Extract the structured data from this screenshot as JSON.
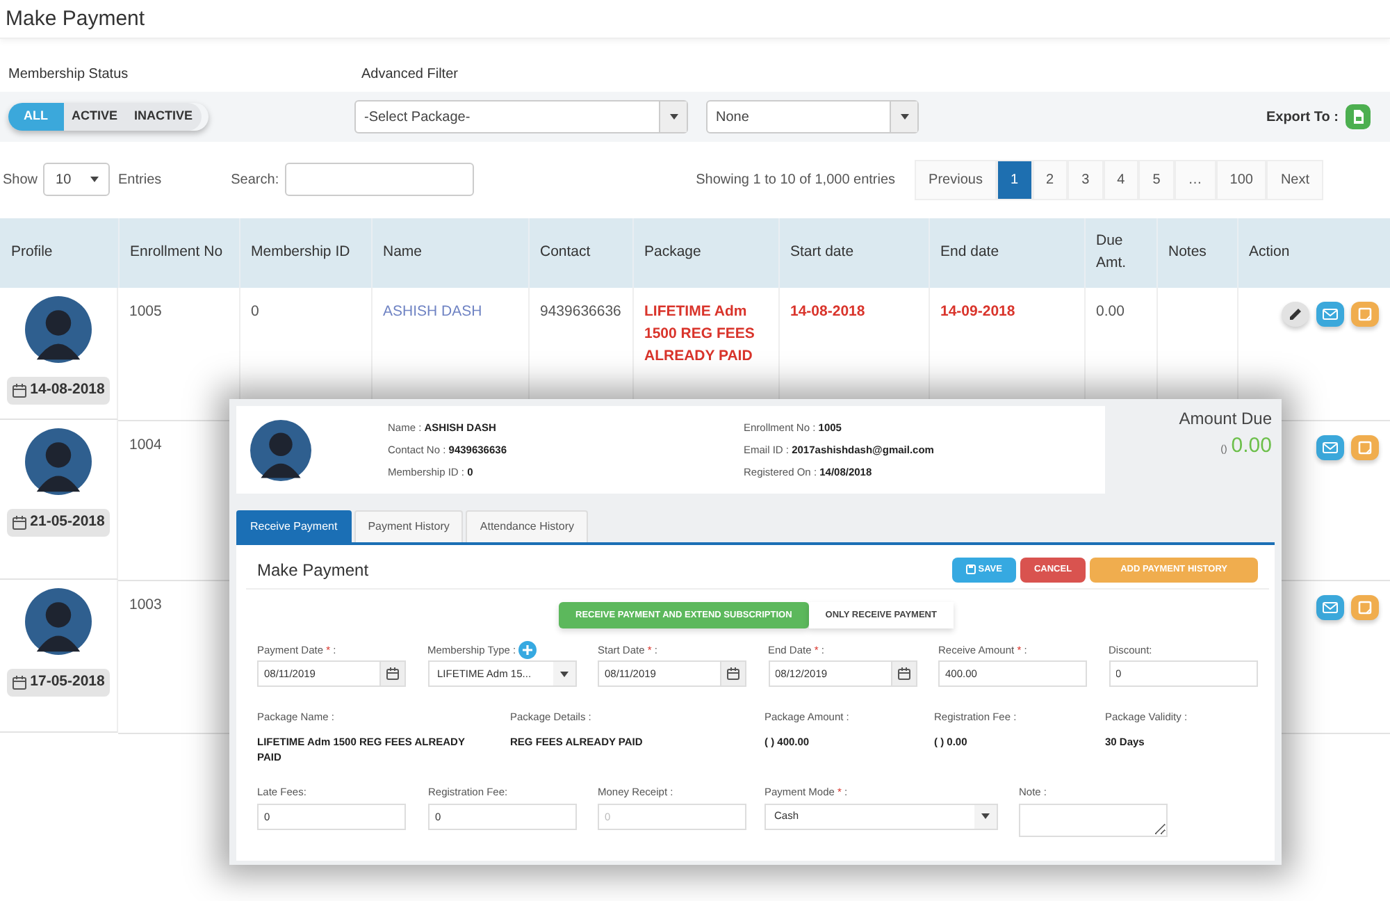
{
  "page_title": "Make Payment",
  "filters": {
    "membership_status_label": "Membership Status",
    "status_options": [
      {
        "label": "ALL",
        "selected": true
      },
      {
        "label": "ACTIVE",
        "selected": false
      },
      {
        "label": "INACTIVE",
        "selected": false
      }
    ],
    "advanced_filter_label": "Advanced Filter",
    "package_select": "-Select Package-",
    "second_select": "None",
    "export_label": "Export To :"
  },
  "listing": {
    "show_label": "Show",
    "entries_select": "10",
    "entries_label": "Entries",
    "search_label": "Search:",
    "info": "Showing 1 to 10 of 1,000 entries",
    "pages": [
      {
        "label": "Previous",
        "selected": false
      },
      {
        "label": "1",
        "selected": true
      },
      {
        "label": "2",
        "selected": false
      },
      {
        "label": "3",
        "selected": false
      },
      {
        "label": "4",
        "selected": false
      },
      {
        "label": "5",
        "selected": false
      },
      {
        "label": "…",
        "selected": false
      },
      {
        "label": "100",
        "selected": false
      },
      {
        "label": "Next",
        "selected": false
      }
    ]
  },
  "table": {
    "columns": [
      "Profile",
      "Enrollment No",
      "Membership ID",
      "Name",
      "Contact",
      "Package",
      "Start date",
      "End date",
      "Due Amt.",
      "Notes",
      "Action"
    ],
    "rows": [
      {
        "join_date": "14-08-2018",
        "enrollment_no": "1005",
        "membership_id": "0",
        "name": "ASHISH DASH",
        "contact": "9439636636",
        "package": "LIFETIME Adm 1500 REG FEES ALREADY PAID",
        "start_date": "14-08-2018",
        "end_date": "14-09-2018",
        "due_amount": "0.00",
        "actions": [
          {
            "kind": "edit"
          },
          {
            "kind": "mail"
          },
          {
            "kind": "note"
          }
        ]
      },
      {
        "join_date": "21-05-2018",
        "enrollment_no": "1004",
        "actions": [
          {
            "kind": "mail"
          },
          {
            "kind": "note"
          }
        ]
      },
      {
        "join_date": "17-05-2018",
        "enrollment_no": "1003",
        "actions": [
          {
            "kind": "mail"
          },
          {
            "kind": "note"
          }
        ]
      }
    ]
  },
  "dialog": {
    "member_info": [
      {
        "label": "Name :",
        "value": "ASHISH DASH"
      },
      {
        "label": "Enrollment No :",
        "value": "1005"
      },
      {
        "label": "Contact No :",
        "value": "9439636636"
      },
      {
        "label": "Email ID :",
        "value": "2017ashishdash@gmail.com"
      },
      {
        "label": "Membership ID :",
        "value": "0"
      },
      {
        "label": "Registered On :",
        "value": "14/08/2018"
      }
    ],
    "amount_due": {
      "label": "Amount Due",
      "currency": "()",
      "value": "0.00"
    },
    "tabs": [
      {
        "label": "Receive Payment",
        "selected": true
      },
      {
        "label": "Payment History",
        "selected": false
      },
      {
        "label": "Attendance History",
        "selected": false
      }
    ],
    "section_title": "Make Payment",
    "buttons": [
      {
        "kind": "save",
        "label": "SAVE"
      },
      {
        "kind": "cancel",
        "label": "CANCEL"
      },
      {
        "kind": "add",
        "label": "ADD PAYMENT HISTORY"
      }
    ],
    "modes": [
      {
        "label": "RECEIVE PAYMENT AND EXTEND SUBSCRIPTION",
        "selected": true
      },
      {
        "label": "ONLY RECEIVE PAYMENT",
        "selected": false
      }
    ],
    "fields": [
      {
        "kind": "date",
        "label": "Payment Date",
        "required_mark": "*",
        "suffix": ":",
        "value": "08/11/2019",
        "disabled": false
      },
      {
        "kind": "select",
        "label": "Membership Type :",
        "value": "LIFETIME Adm 15...",
        "add_button": true,
        "disabled": false
      },
      {
        "kind": "date",
        "label": "Start Date",
        "required_mark": "*",
        "suffix": ":",
        "value": "08/11/2019",
        "disabled": false
      },
      {
        "kind": "date",
        "label": "End Date",
        "required_mark": "*",
        "suffix": ":",
        "value": "08/12/2019",
        "disabled": false
      },
      {
        "kind": "text",
        "label": "Receive Amount",
        "required_mark": "*",
        "suffix": ":",
        "value": "400.00",
        "disabled": false
      },
      {
        "kind": "text",
        "label": "Discount:",
        "value": "0",
        "disabled": false
      }
    ],
    "package_info": [
      {
        "label": "Package Name :",
        "value": "LIFETIME Adm 1500 REG FEES ALREADY PAID"
      },
      {
        "label": "Package Details :",
        "value": "REG FEES ALREADY PAID"
      },
      {
        "label": "Package Amount :",
        "value": "( ) 400.00"
      },
      {
        "label": "Registration Fee :",
        "value": "( ) 0.00"
      },
      {
        "label": "Package Validity :",
        "value": "30 Days"
      }
    ],
    "fields2": [
      {
        "kind": "text",
        "label": "Late Fees:",
        "value": "0",
        "disabled": false
      },
      {
        "kind": "text",
        "label": "Registration Fee:",
        "value": "0",
        "disabled": false
      },
      {
        "kind": "text",
        "label": "Money Receipt :",
        "value": "0",
        "disabled": true
      },
      {
        "kind": "select",
        "label": "Payment Mode",
        "required_mark": "*",
        "suffix": ":",
        "value": "Cash",
        "disabled": false
      },
      {
        "kind": "textarea",
        "label": "Note :",
        "disabled": false
      }
    ]
  }
}
